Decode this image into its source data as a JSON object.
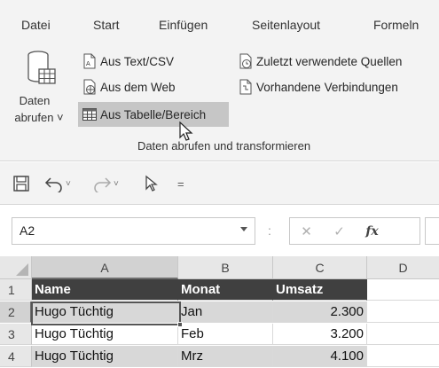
{
  "ribbon": {
    "tabs": [
      "Datei",
      "Start",
      "Einfügen",
      "Seitenlayout",
      "Formeln"
    ],
    "get_data": {
      "line1": "Daten",
      "line2": "abrufen ˅"
    },
    "commands": {
      "from_text_csv": "Aus Text/CSV",
      "from_web": "Aus dem Web",
      "from_table_range": "Aus Tabelle/Bereich",
      "recent_sources": "Zuletzt verwendete Quellen",
      "existing_connections": "Vorhandene Verbindungen"
    },
    "group_label": "Daten abrufen und transformieren"
  },
  "qat": {
    "undo_dd": "˅",
    "redo_dd": "˅",
    "customize": "="
  },
  "formula_bar": {
    "name_box": "A2",
    "separator": ":",
    "cancel": "✕",
    "enter": "✓",
    "fx": "fx"
  },
  "grid": {
    "columns": [
      "A",
      "B",
      "C",
      "D"
    ],
    "rows": [
      {
        "num": "1",
        "cells": [
          "Name",
          "Monat",
          "Umsatz"
        ]
      },
      {
        "num": "2",
        "cells": [
          "Hugo Tüchtig",
          "Jan",
          "2.300"
        ]
      },
      {
        "num": "3",
        "cells": [
          "Hugo Tüchtig",
          "Feb",
          "3.200"
        ]
      },
      {
        "num": "4",
        "cells": [
          "Hugo Tüchtig",
          "Mrz",
          "4.100"
        ]
      }
    ]
  },
  "colors": {
    "header_fill": "#404040",
    "band_fill": "#d8d8d8",
    "hover_fill": "#c6c6c6"
  }
}
